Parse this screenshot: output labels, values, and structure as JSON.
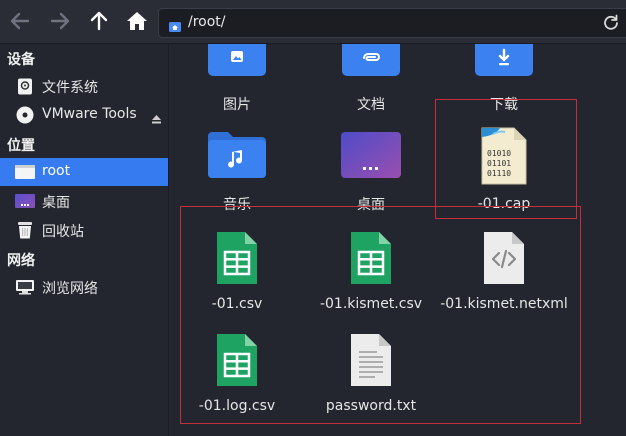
{
  "toolbar": {
    "path": "/root/"
  },
  "sidebar": {
    "sections": {
      "devices": "设备",
      "places": "位置",
      "network": "网络"
    },
    "items": {
      "filesystem": "文件系统",
      "vmware": "VMware Tools",
      "root": "root",
      "desktop": "桌面",
      "trash": "回收站",
      "browse_network": "浏览网络"
    }
  },
  "files": {
    "pictures": "图片",
    "documents": "文档",
    "downloads": "下载",
    "music": "音乐",
    "desktop": "桌面",
    "cap": "-01.cap",
    "csv": "-01.csv",
    "kismet_csv": "-01.kismet.csv",
    "kismet_netxml": "-01.kismet.netxml",
    "log_csv": "-01.log.csv",
    "password": "password.txt"
  },
  "colors": {
    "accent": "#367bf0",
    "folder": "#3b82f0",
    "sheet": "#1fa363",
    "highlight": "#c4303a"
  }
}
